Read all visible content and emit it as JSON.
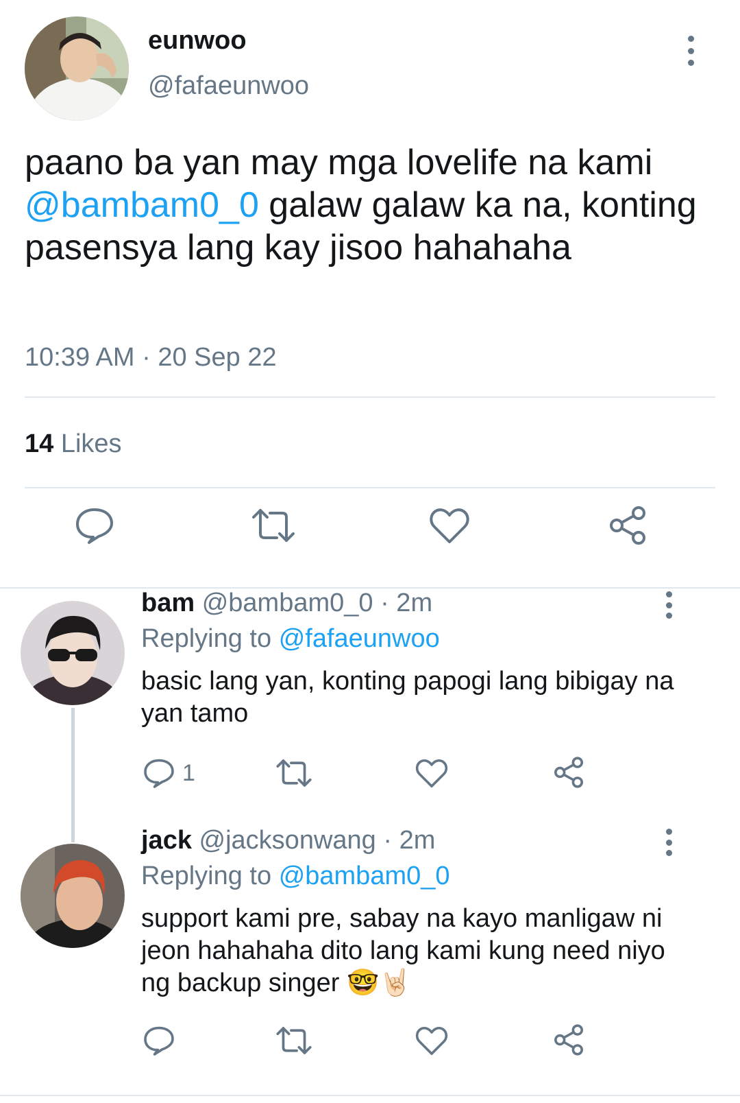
{
  "main_tweet": {
    "author_name": "eunwoo",
    "author_handle": "@fafaeunwoo",
    "text_before": "paano ba yan may mga lovelife na kami",
    "mention": "@bambam0_0",
    "text_after": " galaw galaw ka na, konting pasensya lang kay jisoo hahahaha",
    "timestamp": "10:39 AM · 20 Sep 22",
    "likes_count": "14",
    "likes_label": "Likes",
    "actions": [
      "reply-icon",
      "retweet-icon",
      "like-icon",
      "share-icon"
    ]
  },
  "replies": [
    {
      "author_name": "bam",
      "author_handle": "@bambam0_0",
      "age": "· 2m",
      "replying_label": "Replying to",
      "replying_to": "@fafaeunwoo",
      "text": "basic lang yan, konting papogi lang bibigay na yan tamo",
      "reply_count": "1"
    },
    {
      "author_name": "jack",
      "author_handle": "@jacksonwang",
      "age": "· 2m",
      "replying_label": "Replying to",
      "replying_to": "@bambam0_0",
      "text": "support kami pre, sabay na kayo manligaw ni jeon hahahaha dito lang kami kung need niyo ng backup singer",
      "emojis": "🤓🤘🏻",
      "reply_count": ""
    }
  ],
  "colors": {
    "accent": "#1da1f2",
    "secondary_text": "#657786",
    "primary_text": "#14171a",
    "divider": "#e1e8ed"
  }
}
